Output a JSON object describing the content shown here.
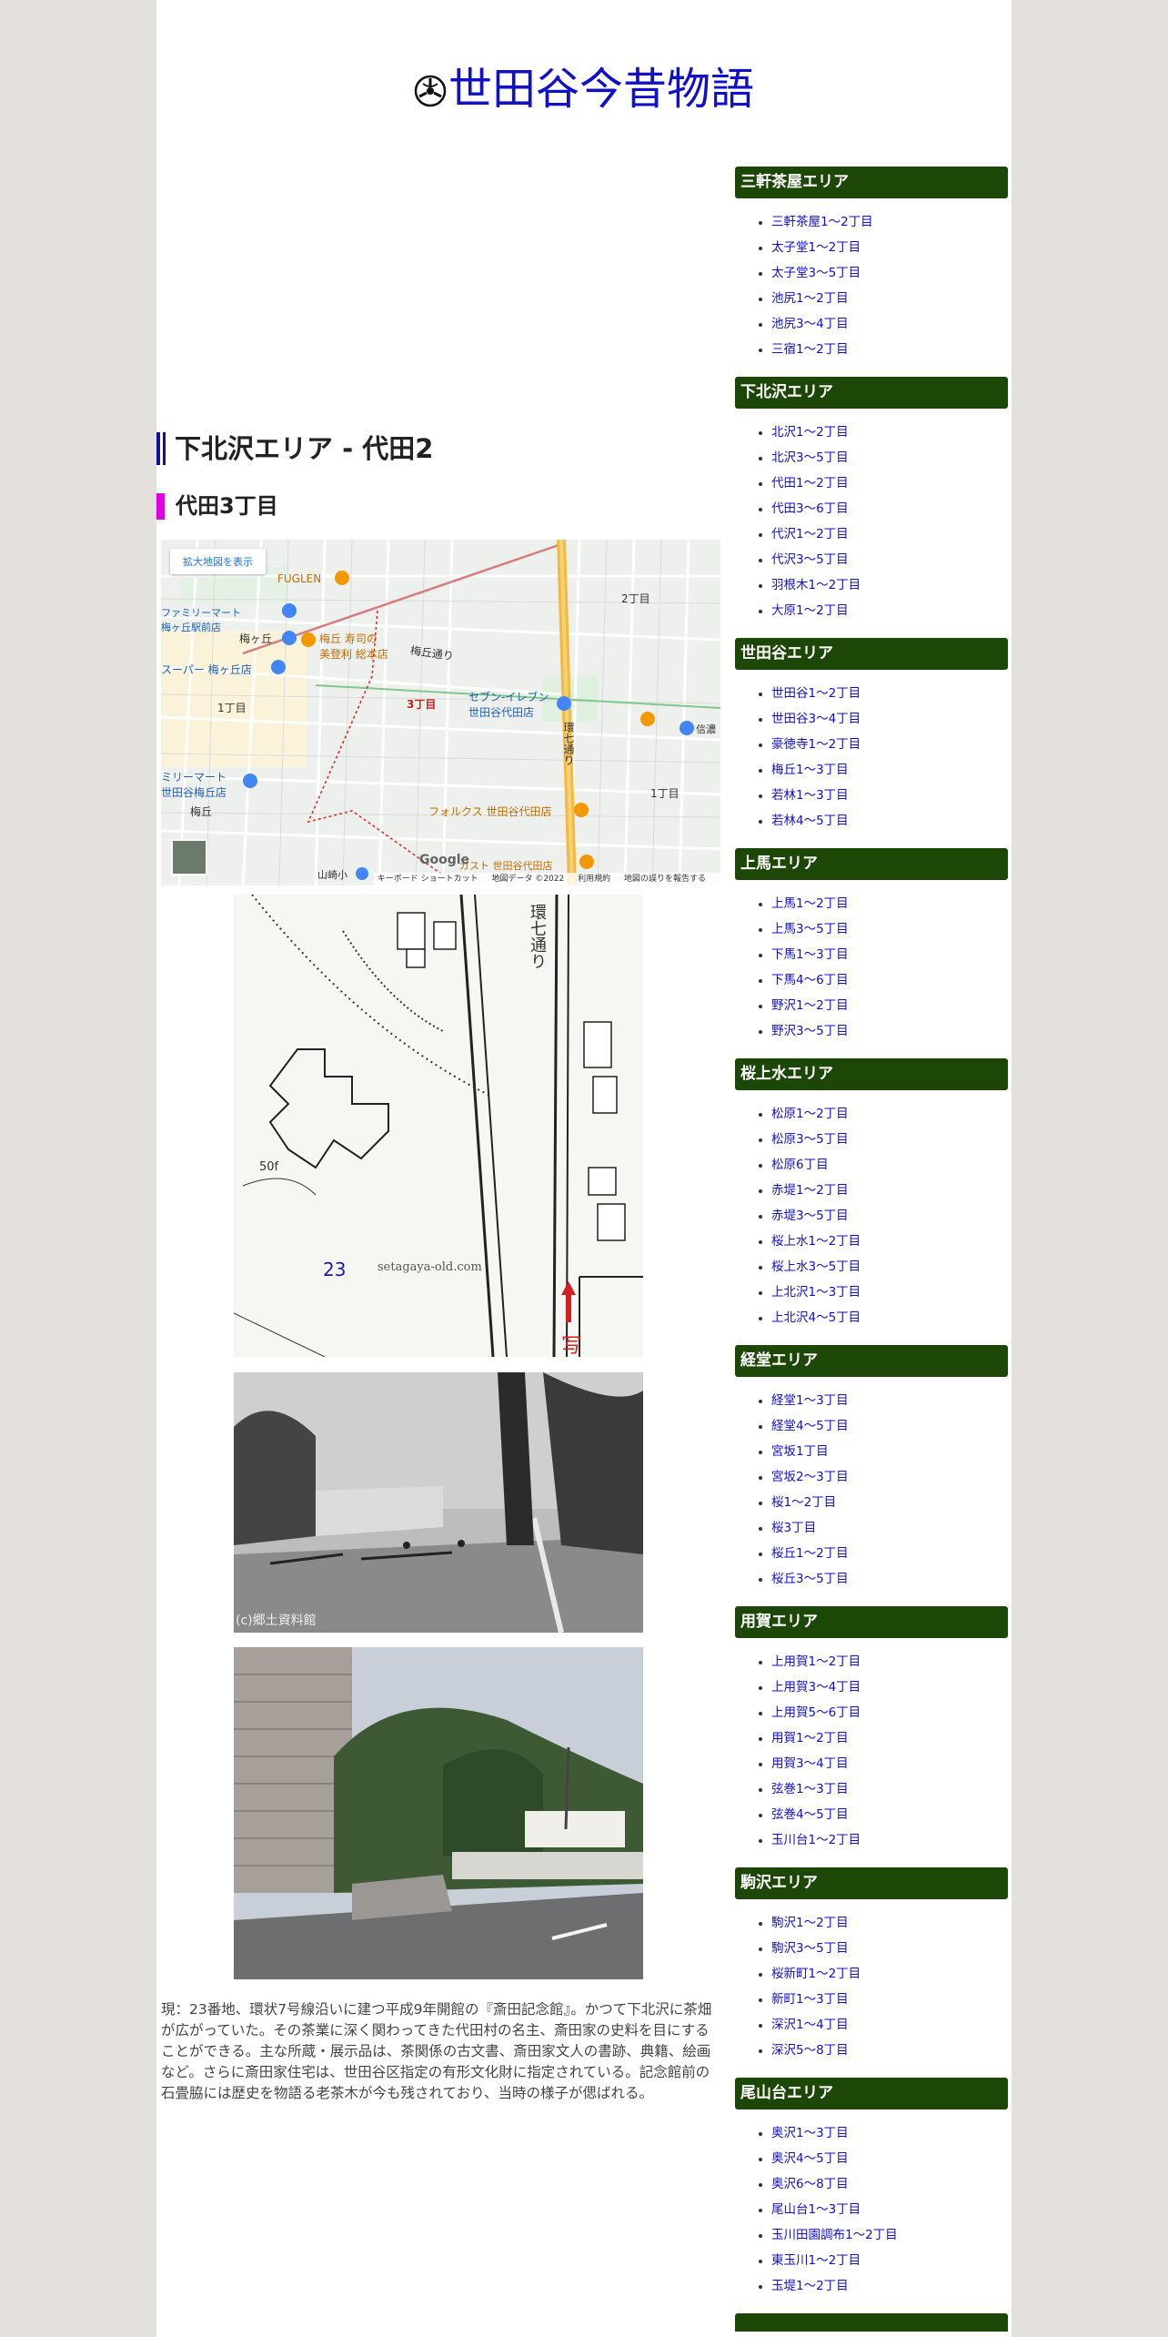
{
  "site": {
    "title": "世田谷今昔物語"
  },
  "main": {
    "heading": "下北沢エリア - 代田2",
    "subheading": "代田3丁目",
    "map": {
      "expand_button": "拡大地図を表示",
      "footer_links": [
        "キーボード ショートカット",
        "地図データ ©2022",
        "利用規約",
        "地図の誤りを報告する"
      ],
      "google_logo": "Google",
      "labels": {
        "fuglen": "FUGLEN",
        "umegaoka_station": "梅ヶ丘",
        "mart_umegaoka": "ファミリーマート\n梅ヶ丘駅前店",
        "sushi": "梅丘 寿司の\n美登利 総本店",
        "umegaoka_dori": "梅丘通り",
        "super": "スーパー 梅ヶ丘店",
        "chome2": "2丁目",
        "chome1_left": "1丁目",
        "chome3": "3丁目",
        "seven": "セブン-イレブン\n世田谷代田店",
        "kanana": "環七通り",
        "mart_left": "ミリーマート\n世田谷梅丘店",
        "umegaoka_area": "梅丘",
        "folks": "フォルクス 世田谷代田店",
        "chome1_right": "1丁目",
        "gusto": "ガスト 世田谷代田店",
        "yamazaki": "山崎小",
        "shinshu": "信濃"
      }
    },
    "old_map_overlay": {
      "number": "23",
      "source": "setagaya-old.com",
      "photo_mark": "写",
      "num_50": "50f",
      "road": "環七通り"
    },
    "old_photo_copyright": "(c)郷土資料館",
    "description": "現：23番地、環状7号線沿いに建つ平成9年開館の『斎田記念館』。かつて下北沢に茶畑が広がっていた。その茶業に深く関わってきた代田村の名主、斎田家の史料を目にすることができる。主な所蔵・展示品は、茶関係の古文書、斎田家文人の書跡、典籍、絵画など。さらに斎田家住宅は、世田谷区指定の有形文化財に指定されている。記念館前の石畳脇には歴史を物語る老茶木が今も残されており、当時の様子が偲ばれる。"
  },
  "sidebar": {
    "areas": [
      {
        "title": "三軒茶屋エリア",
        "items": [
          "三軒茶屋1～2丁目",
          "太子堂1～2丁目",
          "太子堂3～5丁目",
          "池尻1～2丁目",
          "池尻3～4丁目",
          "三宿1～2丁目"
        ]
      },
      {
        "title": "下北沢エリア",
        "items": [
          "北沢1～2丁目",
          "北沢3～5丁目",
          "代田1～2丁目",
          "代田3～6丁目",
          "代沢1～2丁目",
          "代沢3～5丁目",
          "羽根木1～2丁目",
          "大原1～2丁目"
        ]
      },
      {
        "title": "世田谷エリア",
        "items": [
          "世田谷1～2丁目",
          "世田谷3～4丁目",
          "豪徳寺1～2丁目",
          "梅丘1～3丁目",
          "若林1～3丁目",
          "若林4～5丁目"
        ]
      },
      {
        "title": "上馬エリア",
        "items": [
          "上馬1～2丁目",
          "上馬3～5丁目",
          "下馬1～3丁目",
          "下馬4～6丁目",
          "野沢1～2丁目",
          "野沢3～5丁目"
        ]
      },
      {
        "title": "桜上水エリア",
        "items": [
          "松原1～2丁目",
          "松原3～5丁目",
          "松原6丁目",
          "赤堤1～2丁目",
          "赤堤3～5丁目",
          "桜上水1～2丁目",
          "桜上水3～5丁目",
          "上北沢1～3丁目",
          "上北沢4～5丁目"
        ]
      },
      {
        "title": "経堂エリア",
        "items": [
          "経堂1～3丁目",
          "経堂4～5丁目",
          "宮坂1丁目",
          "宮坂2～3丁目",
          "桜1～2丁目",
          "桜3丁目",
          "桜丘1～2丁目",
          "桜丘3～5丁目"
        ]
      },
      {
        "title": "用賀エリア",
        "items": [
          "上用賀1～2丁目",
          "上用賀3～4丁目",
          "上用賀5～6丁目",
          "用賀1～2丁目",
          "用賀3～4丁目",
          "弦巻1～3丁目",
          "弦巻4～5丁目",
          "玉川台1～2丁目"
        ]
      },
      {
        "title": "駒沢エリア",
        "items": [
          "駒沢1～2丁目",
          "駒沢3～5丁目",
          "桜新町1～2丁目",
          "新町1～3丁目",
          "深沢1～4丁目",
          "深沢5～8丁目"
        ]
      },
      {
        "title": "尾山台エリア",
        "items": [
          "奥沢1～3丁目",
          "奥沢4～5丁目",
          "奥沢6～8丁目",
          "尾山台1～3丁目",
          "玉川田園調布1～2丁目",
          "東玉川1～2丁目",
          "玉堤1～2丁目"
        ]
      }
    ]
  }
}
